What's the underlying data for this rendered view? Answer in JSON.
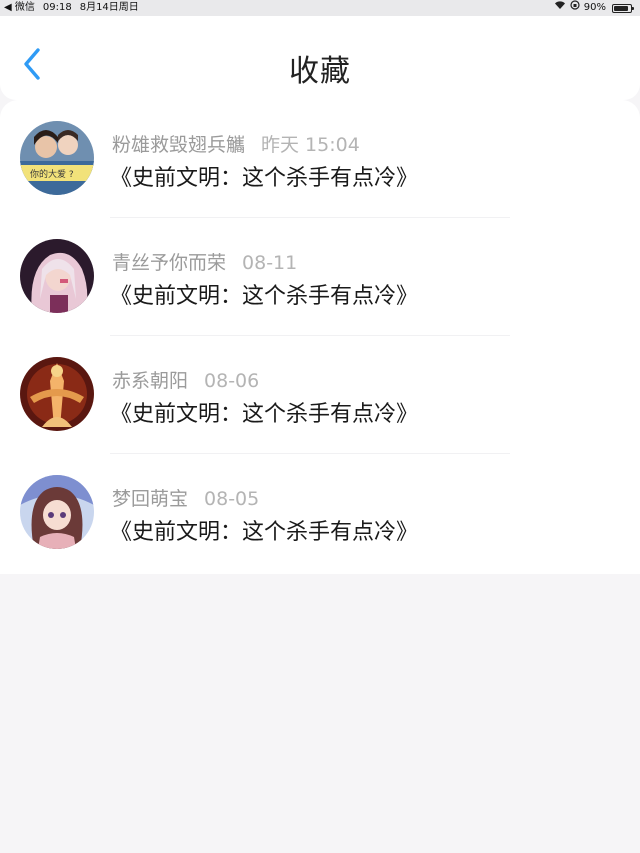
{
  "status_bar": {
    "back_app": "◀ 微信",
    "time": "09:18",
    "date": "8月14日周日",
    "battery": "90%",
    "battery_level": 0.9
  },
  "header": {
    "title": "收藏",
    "back_icon": "chevron-left-icon",
    "accent_color": "#2f9bf5"
  },
  "favorites": [
    {
      "user": "粉雄救毁翅兵觿",
      "time": "昨天 15:04",
      "title": "《史前文明：这个杀手有点冷》",
      "avatar_caption": "你的大爱 ?"
    },
    {
      "user": "青丝予你而荣",
      "time": "08-11",
      "title": "《史前文明：这个杀手有点冷》"
    },
    {
      "user": "赤系朝阳",
      "time": "08-06",
      "title": "《史前文明：这个杀手有点冷》"
    },
    {
      "user": "梦回萌宝",
      "time": "08-05",
      "title": "《史前文明：这个杀手有点冷》"
    }
  ]
}
